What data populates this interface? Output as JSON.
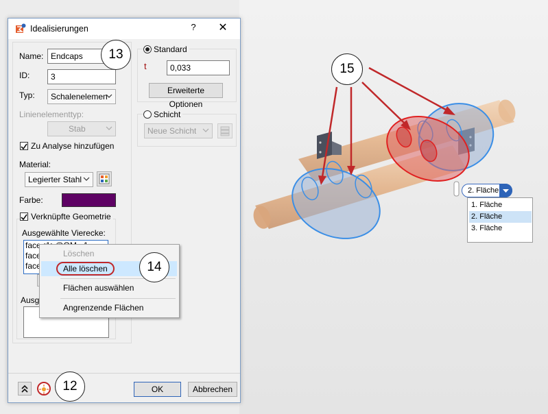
{
  "dialog": {
    "title": "Idealisierungen",
    "help": "?",
    "close": "✕",
    "name_label": "Name:",
    "name_value": "Endcaps",
    "id_label": "ID:",
    "id_value": "3",
    "type_label": "Typ:",
    "type_value": "Schalenelemente",
    "line_type_label": "Linienelementtyp:",
    "line_type_value": "Stab",
    "add_analysis_label": "Zu Analyse hinzufügen",
    "material_label": "Material:",
    "material_value": "Legierter Stahl",
    "color_label": "Farbe:",
    "color_value": "#5e0264",
    "linked_geometry_label": "Verknüpfte Geometrie",
    "selected_quads_label": "Ausgewählte Vierecke:",
    "face_items": [
      "face<1>@OM...1",
      "face<2>@OM...1",
      "face<3>@OM...1"
    ],
    "lower_label_partial": "Ausge",
    "standard_label": "Standard",
    "t_label": "t",
    "thickness_value": "0,033",
    "extended_options_label": "Erweiterte Optionen",
    "layer_label": "Schicht",
    "new_layer_value": "Neue Schicht",
    "ok_label": "OK",
    "cancel_label": "Abbrechen"
  },
  "context_menu": {
    "items": [
      {
        "label": "Löschen",
        "enabled": false
      },
      {
        "label": "Alle löschen",
        "enabled": true
      },
      {
        "label": "Flächen auswählen",
        "enabled": true
      },
      {
        "label": "Angrenzende Flächen",
        "enabled": true
      }
    ]
  },
  "callouts": {
    "c12": "12",
    "c13": "13",
    "c14": "14",
    "c15": "15"
  },
  "viewport": {
    "face_dropdown_value": "2. Fläche",
    "face_options": [
      "1. Fläche",
      "2. Fläche",
      "3. Fläche"
    ]
  },
  "colors": {
    "accent": "#2e64b8",
    "callout_ring": "#c0282a",
    "selection_red": "#e02020",
    "selection_blue": "#3a8ee6",
    "pipe": "#e8b88a"
  }
}
